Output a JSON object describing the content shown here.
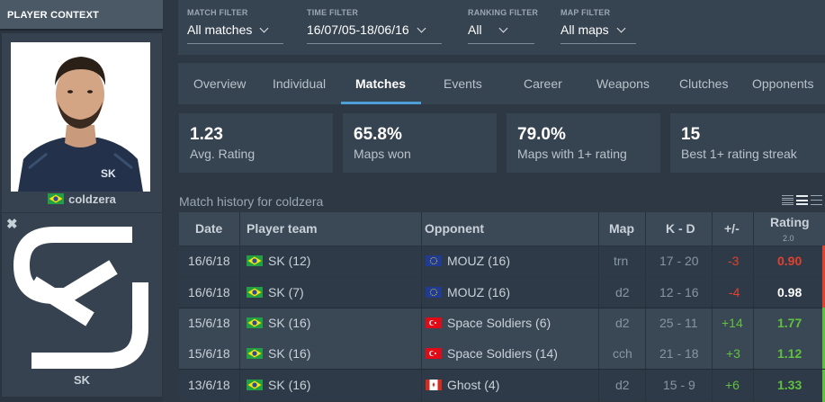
{
  "context": {
    "title": "PLAYER CONTEXT",
    "player": {
      "name": "coldzera",
      "flag": "brazil"
    },
    "team": {
      "name": "SK",
      "logo": "sk-logo"
    }
  },
  "filters": [
    {
      "label": "MATCH FILTER",
      "value": "All matches"
    },
    {
      "label": "TIME FILTER",
      "value": "16/07/05-18/06/16"
    },
    {
      "label": "RANKING FILTER",
      "value": "All"
    },
    {
      "label": "MAP FILTER",
      "value": "All maps"
    }
  ],
  "tabs": [
    "Overview",
    "Individual",
    "Matches",
    "Events",
    "Career",
    "Weapons",
    "Clutches",
    "Opponents"
  ],
  "active_tab": "Matches",
  "stats": [
    {
      "value": "1.23",
      "label": "Avg. Rating"
    },
    {
      "value": "65.8%",
      "label": "Maps won"
    },
    {
      "value": "79.0%",
      "label": "Maps with 1+ rating"
    },
    {
      "value": "15",
      "label": "Best 1+ rating streak"
    }
  ],
  "history": {
    "title": "Match history for coldzera",
    "columns": {
      "date": "Date",
      "team": "Player team",
      "opponent": "Opponent",
      "map": "Map",
      "kd": "K - D",
      "diff": "+/-",
      "rating": "Rating",
      "rating_sub": "2.0"
    },
    "rows": [
      {
        "date": "16/6/18",
        "team": "SK (12)",
        "team_flag": "brazil",
        "opponent": "MOUZ (16)",
        "opp_flag": "eu",
        "map": "trn",
        "kd": "17 - 20",
        "diff": "-3",
        "rating": "0.90"
      },
      {
        "date": "16/6/18",
        "team": "SK (7)",
        "team_flag": "brazil",
        "opponent": "MOUZ (16)",
        "opp_flag": "eu",
        "map": "d2",
        "kd": "12 - 16",
        "diff": "-4",
        "rating": "0.98"
      },
      {
        "date": "15/6/18",
        "team": "SK (16)",
        "team_flag": "brazil",
        "opponent": "Space Soldiers (6)",
        "opp_flag": "turkey",
        "map": "d2",
        "kd": "25 - 11",
        "diff": "+14",
        "rating": "1.77"
      },
      {
        "date": "15/6/18",
        "team": "SK (16)",
        "team_flag": "brazil",
        "opponent": "Space Soldiers (14)",
        "opp_flag": "turkey",
        "map": "cch",
        "kd": "21 - 18",
        "diff": "+3",
        "rating": "1.12"
      },
      {
        "date": "13/6/18",
        "team": "SK (16)",
        "team_flag": "brazil",
        "opponent": "Ghost (4)",
        "opp_flag": "canada",
        "map": "d2",
        "kd": "15 - 9",
        "diff": "+6",
        "rating": "1.33"
      }
    ]
  },
  "colors": {
    "accent": "#4e9fd8",
    "positive": "#60c13f",
    "negative": "#e2412f"
  }
}
